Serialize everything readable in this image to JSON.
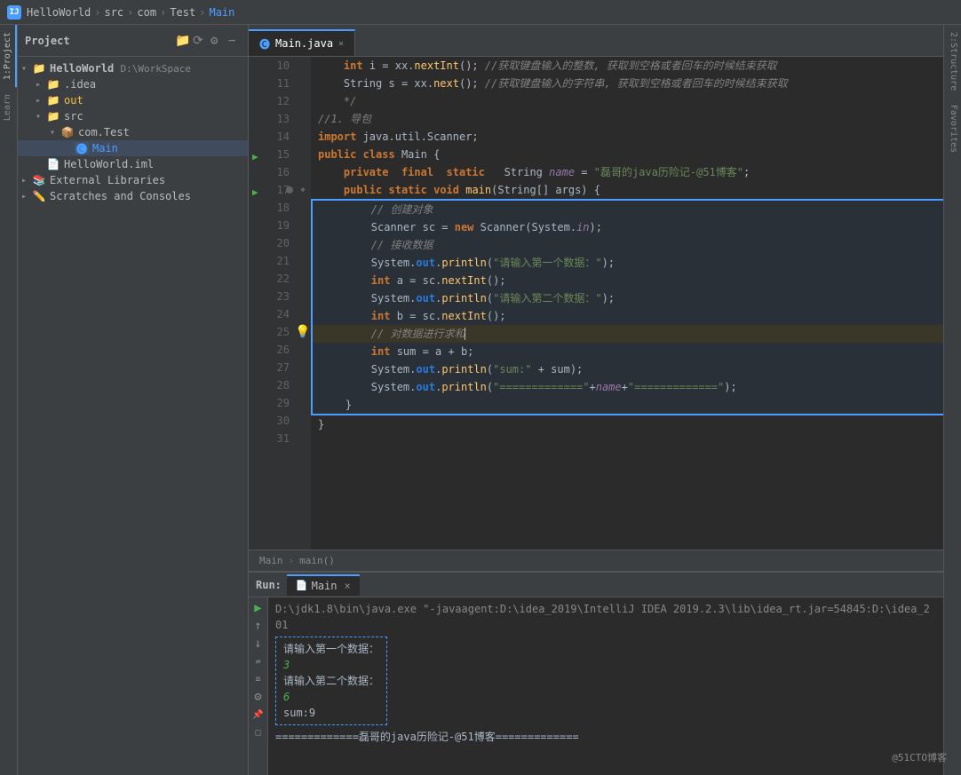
{
  "titleBar": {
    "logo": "IJ",
    "breadcrumbs": [
      "HelloWorld",
      "src",
      "com",
      "Test",
      "Main"
    ]
  },
  "tabs": {
    "project": "Project",
    "active": "Main.java"
  },
  "sideTabs": [
    "1:Project",
    "Learn",
    "2:Structure",
    "Favorites"
  ],
  "projectTree": {
    "items": [
      {
        "id": "helloworld",
        "label": "HelloWorld",
        "sublabel": "D:\\WorkSpace",
        "indent": 0,
        "type": "project",
        "icon": "📁",
        "expanded": true
      },
      {
        "id": "idea",
        "label": ".idea",
        "indent": 1,
        "type": "folder",
        "icon": "📁",
        "expanded": false
      },
      {
        "id": "out",
        "label": "out",
        "indent": 1,
        "type": "folder-yellow",
        "icon": "📁",
        "expanded": false
      },
      {
        "id": "src",
        "label": "src",
        "indent": 1,
        "type": "folder",
        "icon": "📁",
        "expanded": true
      },
      {
        "id": "comtest",
        "label": "com.Test",
        "indent": 2,
        "type": "package",
        "icon": "📦",
        "expanded": true
      },
      {
        "id": "main",
        "label": "Main",
        "indent": 3,
        "type": "class",
        "icon": "C",
        "expanded": false
      },
      {
        "id": "helloworldiml",
        "label": "HelloWorld.iml",
        "indent": 1,
        "type": "iml",
        "icon": "📄"
      },
      {
        "id": "extlibs",
        "label": "External Libraries",
        "indent": 0,
        "type": "libs",
        "icon": "📚",
        "expanded": false
      },
      {
        "id": "scratches",
        "label": "Scratches and Consoles",
        "indent": 0,
        "type": "scratches",
        "icon": "✏️",
        "expanded": false
      }
    ]
  },
  "editor": {
    "filename": "Main.java",
    "lines": [
      {
        "num": 10,
        "gutter": "",
        "code": "    int i = xx.nextInt();",
        "comment": "获取键盘输入的整数, 获取到空格或者回车的时候结束获取",
        "type": "normal"
      },
      {
        "num": 11,
        "gutter": "",
        "code": "    String s = xx.next();",
        "comment": "获取键盘输入的字符串, 获取到空格或者回车的时候结束获取",
        "type": "normal"
      },
      {
        "num": 12,
        "gutter": "",
        "code": "    */",
        "type": "normal"
      },
      {
        "num": 13,
        "gutter": "",
        "code": "//1. 导包",
        "type": "normal"
      },
      {
        "num": 14,
        "gutter": "",
        "code": "import java.util.Scanner;",
        "type": "normal"
      },
      {
        "num": 15,
        "gutter": "▶",
        "code": "public class Main {",
        "type": "normal"
      },
      {
        "num": 16,
        "gutter": "",
        "code": "    private  final  static   String name = \"磊哥的java历险记-@51博客\";",
        "type": "normal"
      },
      {
        "num": 17,
        "gutter": "▶",
        "code": "    public static void main(String[] args) {",
        "type": "normal",
        "bookmark": true
      },
      {
        "num": 18,
        "gutter": "",
        "code": "        // 创建对象",
        "type": "comment-cn",
        "sel": true
      },
      {
        "num": 19,
        "gutter": "",
        "code": "        Scanner sc = new Scanner(System.in);",
        "type": "sel"
      },
      {
        "num": 20,
        "gutter": "",
        "code": "        // 接收数据",
        "type": "comment-cn",
        "sel": true
      },
      {
        "num": 21,
        "gutter": "",
        "code": "        System.out.println(\"请输入第一个数据：\");",
        "type": "sel"
      },
      {
        "num": 22,
        "gutter": "",
        "code": "        int a = sc.nextInt();",
        "type": "sel"
      },
      {
        "num": 23,
        "gutter": "",
        "code": "        System.out.println(\"请输入第二个数据：\");",
        "type": "sel"
      },
      {
        "num": 24,
        "gutter": "",
        "code": "        int b = sc.nextInt();",
        "type": "sel"
      },
      {
        "num": 25,
        "gutter": "⚠",
        "code": "        // 对数据进行求和|",
        "type": "warn",
        "sel": true
      },
      {
        "num": 26,
        "gutter": "",
        "code": "        int sum = a + b;",
        "type": "sel"
      },
      {
        "num": 27,
        "gutter": "",
        "code": "        System.out.println(\"sum:\" + sum);",
        "type": "sel"
      },
      {
        "num": 28,
        "gutter": "",
        "code": "        System.out.println(\"=============\"+name+\"=============\");",
        "type": "sel"
      },
      {
        "num": 29,
        "gutter": "",
        "code": "    }",
        "type": "sel-last"
      },
      {
        "num": 30,
        "gutter": "",
        "code": "}",
        "type": "normal"
      },
      {
        "num": 31,
        "gutter": "",
        "code": "",
        "type": "normal"
      }
    ],
    "breadcrumb": [
      "Main",
      "main()"
    ]
  },
  "runPanel": {
    "label": "Run:",
    "tabName": "Main",
    "cmdLine": "D:\\jdk1.8\\bin\\java.exe \"-javaagent:D:\\idea_2019\\IntelliJ IDEA 2019.2.3\\lib\\idea_rt.jar=54845:D:\\idea_201",
    "outputLines": [
      "请输入第一个数据：",
      "3",
      "请输入第二个数据：",
      "6",
      "sum:9"
    ],
    "finalLine": "=============磊哥的java历险记-@51博客============="
  },
  "watermark": "@51CTO博客",
  "icons": {
    "play": "▶",
    "stop": "■",
    "rerun": "↺",
    "close": "×",
    "folder": "📁",
    "settings": "⚙",
    "sync": "⟳",
    "minus": "−",
    "arrowRight": "▶",
    "expand": "▸",
    "collapse": "▾",
    "warning": "💡"
  }
}
